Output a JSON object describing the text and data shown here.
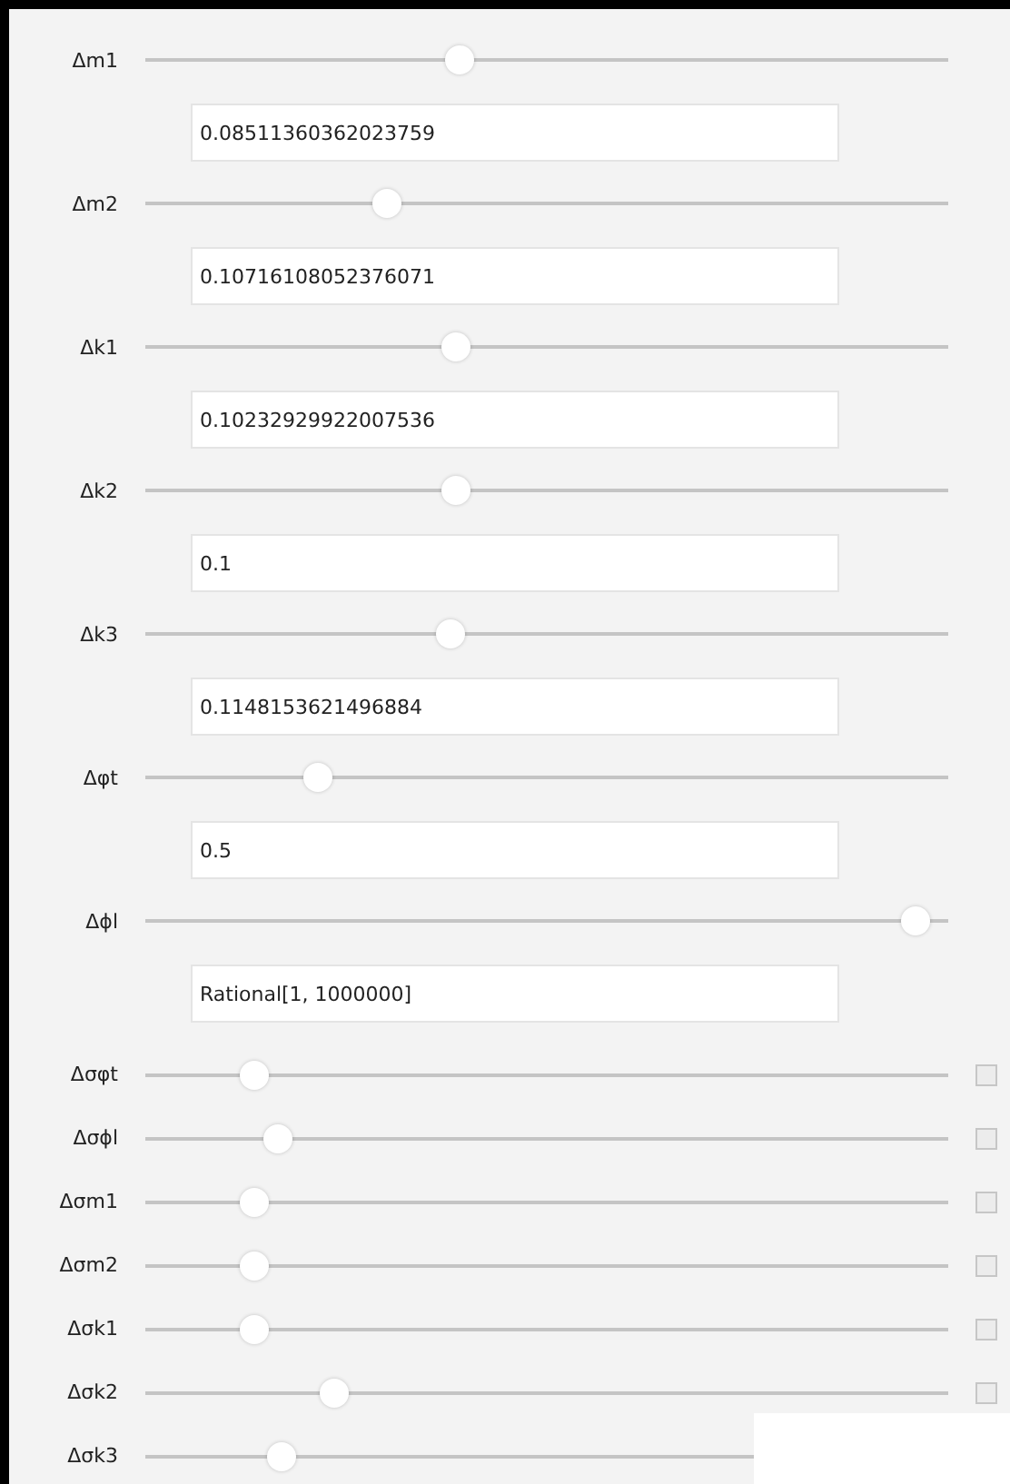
{
  "controls": [
    {
      "kind": "slider",
      "label": "Δm1",
      "level": 0.387,
      "value": "0.08511360362023759"
    },
    {
      "kind": "slider",
      "label": "Δm2",
      "level": 0.294,
      "value": "0.10716108052376071"
    },
    {
      "kind": "slider",
      "label": "Δk1",
      "level": 0.382,
      "value": "0.10232929922007536"
    },
    {
      "kind": "slider",
      "label": "Δk2",
      "level": 0.382,
      "value": "0.1"
    },
    {
      "kind": "slider",
      "label": "Δk3",
      "level": 0.376,
      "value": "0.1148153621496884"
    },
    {
      "kind": "slider",
      "label": "Δφt",
      "level": 0.204,
      "value": "0.5"
    },
    {
      "kind": "slider",
      "label": "Δϕl",
      "level": 0.977,
      "value": "Rational[1, 1000000]"
    },
    {
      "kind": "compact",
      "label": "Δσφt",
      "level": 0.122
    },
    {
      "kind": "compact",
      "label": "Δσϕl",
      "level": 0.152
    },
    {
      "kind": "compact",
      "label": "Δσm1",
      "level": 0.122
    },
    {
      "kind": "compact",
      "label": "Δσm2",
      "level": 0.122
    },
    {
      "kind": "compact",
      "label": "Δσk1",
      "level": 0.122
    },
    {
      "kind": "compact",
      "label": "Δσk2",
      "level": 0.226
    },
    {
      "kind": "plain",
      "label": "Δσk3",
      "level": 0.158
    }
  ]
}
